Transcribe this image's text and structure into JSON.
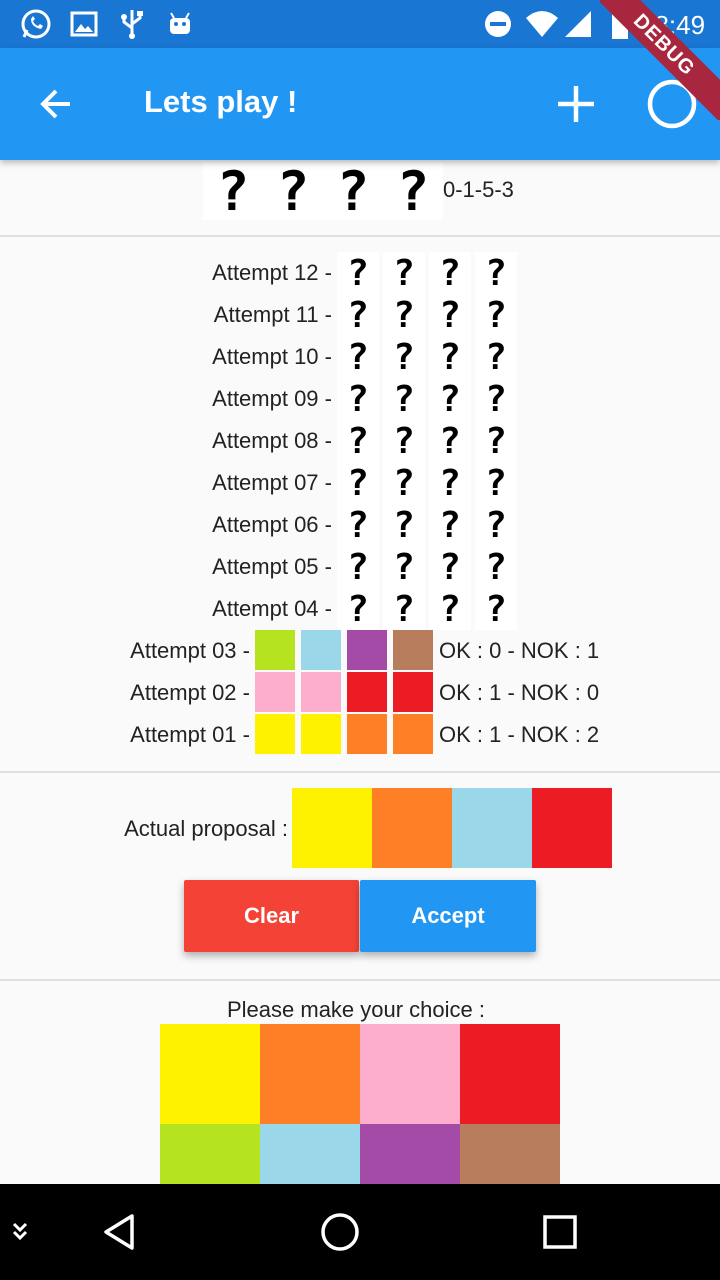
{
  "status_bar": {
    "time": "18:49",
    "icons": [
      "whatsapp-icon",
      "image-icon",
      "usb-icon",
      "android-icon",
      "do-not-disturb-icon",
      "wifi-icon",
      "signal-icon",
      "battery-icon"
    ]
  },
  "app_bar": {
    "title": "Lets play !",
    "debug_banner": "DEBUG",
    "icons": [
      "back-arrow-icon",
      "add-icon",
      "circle-icon"
    ]
  },
  "secret": {
    "hidden_glyph": "?",
    "code_text": "0-1-5-3"
  },
  "attempts": [
    {
      "label": "Attempt 12 -",
      "colors": null,
      "result": ""
    },
    {
      "label": "Attempt 11 -",
      "colors": null,
      "result": ""
    },
    {
      "label": "Attempt 10 -",
      "colors": null,
      "result": ""
    },
    {
      "label": "Attempt 09 -",
      "colors": null,
      "result": ""
    },
    {
      "label": "Attempt 08 -",
      "colors": null,
      "result": ""
    },
    {
      "label": "Attempt 07 -",
      "colors": null,
      "result": ""
    },
    {
      "label": "Attempt 06 -",
      "colors": null,
      "result": ""
    },
    {
      "label": "Attempt 05 -",
      "colors": null,
      "result": ""
    },
    {
      "label": "Attempt 04 -",
      "colors": null,
      "result": ""
    },
    {
      "label": "Attempt 03 -",
      "colors": [
        "#b5e31f",
        "#9ad7e8",
        "#a34ba6",
        "#b87d5c"
      ],
      "result": "OK : 0 - NOK : 1"
    },
    {
      "label": "Attempt 02 -",
      "colors": [
        "#fdaecd",
        "#fdaecd",
        "#ec1c24",
        "#ec1c24"
      ],
      "result": "OK : 1 - NOK : 0"
    },
    {
      "label": "Attempt 01 -",
      "colors": [
        "#fff200",
        "#fff200",
        "#ff7f27",
        "#ff7f27"
      ],
      "result": "OK : 1 - NOK : 2"
    }
  ],
  "proposal": {
    "label": "Actual proposal :",
    "colors": [
      "#fff200",
      "#ff7f27",
      "#9ad7e8",
      "#ec1c24"
    ]
  },
  "buttons": {
    "clear": "Clear",
    "accept": "Accept",
    "clear_color": "#f44336",
    "accept_color": "#2196f3"
  },
  "choice": {
    "label": "Please make your choice :",
    "colors": [
      "#fff200",
      "#ff7f27",
      "#fdaecd",
      "#ec1c24",
      "#b5e31f",
      "#9ad7e8",
      "#a34ba6",
      "#b87d5c"
    ]
  },
  "nav_bar": {
    "icons": [
      "keyboard-hide-icon",
      "back-triangle-icon",
      "home-circle-icon",
      "recents-square-icon"
    ]
  }
}
